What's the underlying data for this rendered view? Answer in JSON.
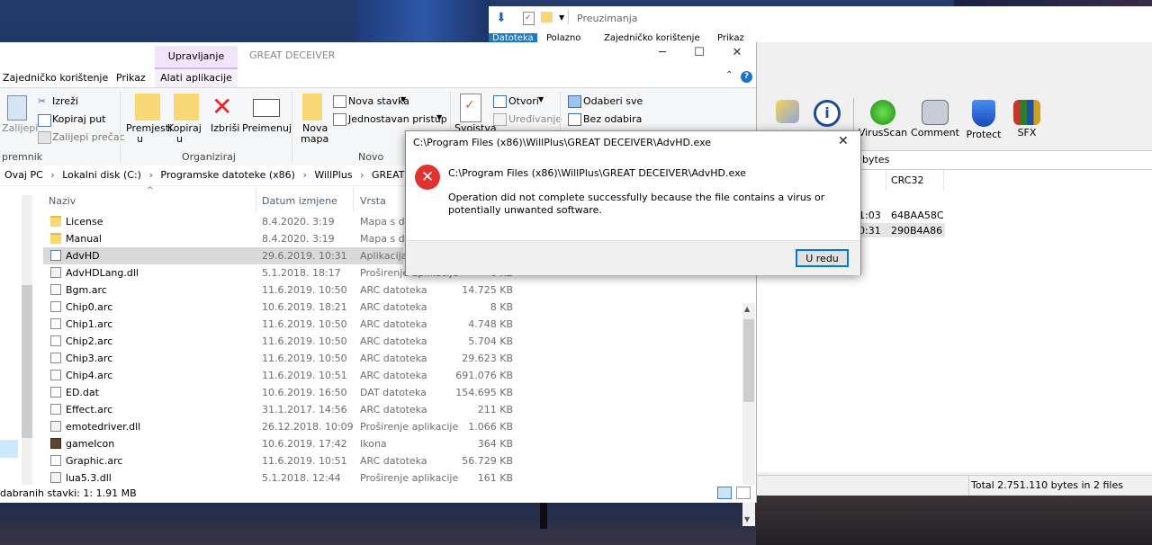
{
  "explorer": {
    "tab_upravljanje": "Upravljanje",
    "title": "GREAT DECEIVER",
    "tabs": [
      "Zajedničko korištenje",
      "Prikaz",
      "Alati aplikacije"
    ],
    "ribbon": {
      "zalijepi": "Zalijepi",
      "izrezi": "Izreži",
      "kopiraj_put": "Kopiraj put",
      "zalijepi_precac": "Zalijepi prečac",
      "premjesti": "Premjesti",
      "premjesti_u": "u",
      "kopiraj": "Kopiraj",
      "kopiraj_u": "u",
      "izbrisi": "Izbriši",
      "preimenuj": "Preimenuj",
      "nova_mapa_1": "Nova",
      "nova_mapa_2": "mapa",
      "nova_stavka": "Nova stavka",
      "jednostavan_pristup": "Jednostavan pristup",
      "svojstva": "Svojstva",
      "otvori": "Otvori",
      "uredivanje": "Uređivanje",
      "odaberi_sve": "Odaberi sve",
      "bez_odabira": "Bez odabira",
      "group_clipboard": "premnik",
      "group_organize": "Organiziraj",
      "group_new": "Novo"
    },
    "breadcrumbs": [
      "Ovaj PC",
      "Lokalni disk (C:)",
      "Programske datoteke (x86)",
      "WillPlus",
      "GREAT DECEIVER"
    ],
    "columns": {
      "name": "Naziv",
      "date": "Datum izmjene",
      "type": "Vrsta"
    },
    "files": [
      {
        "name": "License",
        "date": "8.4.2020. 3:19",
        "type": "Mapa s dat",
        "size": "",
        "icon": "folder-icon"
      },
      {
        "name": "Manual",
        "date": "8.4.2020. 3:19",
        "type": "Mapa s dat",
        "size": "",
        "icon": "folder-icon"
      },
      {
        "name": "AdvHD",
        "date": "29.6.2019. 10:31",
        "type": "Aplikacija",
        "size": "",
        "icon": "app-icon"
      },
      {
        "name": "AdvHDLang.dll",
        "date": "5.1.2018. 18:17",
        "type": "Proširenje aplikacije",
        "size": "6 KB",
        "icon": "dll-icon"
      },
      {
        "name": "Bgm.arc",
        "date": "11.6.2019. 10:50",
        "type": "ARC datoteka",
        "size": "14.725 KB",
        "icon": "file-icon"
      },
      {
        "name": "Chip0.arc",
        "date": "10.6.2019. 18:21",
        "type": "ARC datoteka",
        "size": "8 KB",
        "icon": "file-icon"
      },
      {
        "name": "Chip1.arc",
        "date": "11.6.2019. 10:50",
        "type": "ARC datoteka",
        "size": "4.748 KB",
        "icon": "file-icon"
      },
      {
        "name": "Chip2.arc",
        "date": "11.6.2019. 10:50",
        "type": "ARC datoteka",
        "size": "5.704 KB",
        "icon": "file-icon"
      },
      {
        "name": "Chip3.arc",
        "date": "11.6.2019. 10:50",
        "type": "ARC datoteka",
        "size": "29.623 KB",
        "icon": "file-icon"
      },
      {
        "name": "Chip4.arc",
        "date": "11.6.2019. 10:51",
        "type": "ARC datoteka",
        "size": "691.076 KB",
        "icon": "file-icon"
      },
      {
        "name": "ED.dat",
        "date": "10.6.2019. 16:50",
        "type": "DAT datoteka",
        "size": "154.695 KB",
        "icon": "file-icon"
      },
      {
        "name": "Effect.arc",
        "date": "31.1.2017. 14:56",
        "type": "ARC datoteka",
        "size": "211 KB",
        "icon": "file-icon"
      },
      {
        "name": "emotedriver.dll",
        "date": "26.12.2018. 10:09",
        "type": "Proširenje aplikacije",
        "size": "1.066 KB",
        "icon": "dll-icon"
      },
      {
        "name": "gameIcon",
        "date": "10.6.2019. 17:42",
        "type": "Ikona",
        "size": "364 KB",
        "icon": "image-icon"
      },
      {
        "name": "Graphic.arc",
        "date": "11.6.2019. 10:51",
        "type": "ARC datoteka",
        "size": "56.729 KB",
        "icon": "file-icon"
      },
      {
        "name": "lua5.3.dll",
        "date": "5.1.2018. 12:44",
        "type": "Proširenje aplikacije",
        "size": "161 KB",
        "icon": "dll-icon"
      }
    ],
    "status": "dabranih stavki: 1: 1.91 MB"
  },
  "explorer2": {
    "title": "Preuzimanja",
    "tabs": [
      "Datoteka",
      "Polazno",
      "Zajedničko korištenje",
      "Prikaz"
    ]
  },
  "winrar": {
    "tools": [
      "VirusScan",
      "Comment",
      "Protect",
      "SFX"
    ],
    "bytes_label": "bytes",
    "crc_header": "CRC32",
    "rows": [
      {
        "time": "1:03",
        "crc": "64BAA58C"
      },
      {
        "time": "0:31",
        "crc": "290B4A86"
      }
    ],
    "status": "Total 2.751.110 bytes in 2 files"
  },
  "dialog": {
    "title": "C:\\Program Files (x86)\\WillPlus\\GREAT DECEIVER\\AdvHD.exe",
    "path": "C:\\Program Files (x86)\\WillPlus\\GREAT DECEIVER\\AdvHD.exe",
    "message": "Operation did not complete successfully because the file contains a virus or potentially unwanted software.",
    "ok": "U redu"
  }
}
